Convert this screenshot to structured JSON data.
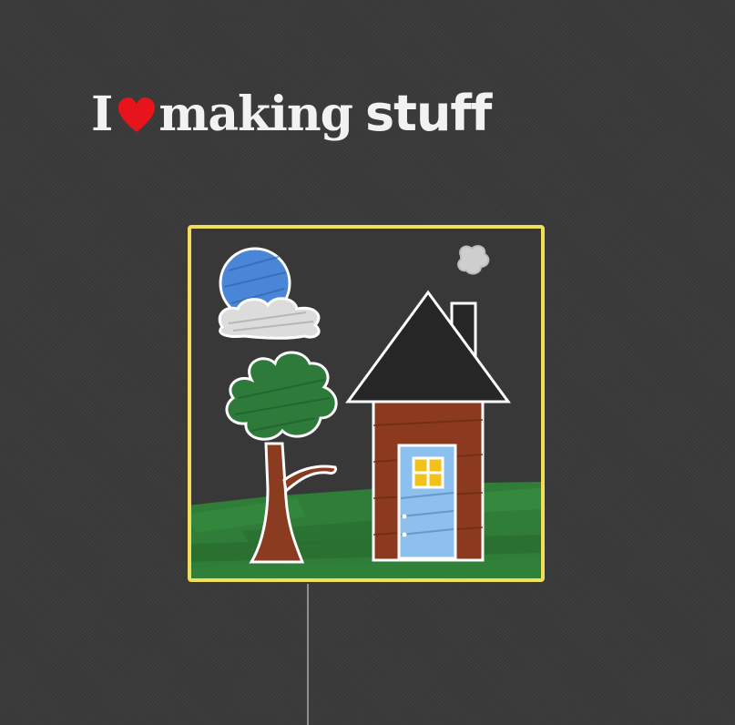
{
  "headline": {
    "word_i": "I",
    "heart_icon": "heart-icon",
    "word_making": "making",
    "word_stuff": "stuff"
  },
  "colors": {
    "background": "#3a3a3a",
    "text": "#f2f2f2",
    "heart": "#e8141b",
    "frame_border": "#f1df5a",
    "sun": "#4a86d8",
    "tree_leaves": "#2e7a3a",
    "tree_trunk": "#8a3b20",
    "grass": "#2f7d38",
    "house_wall": "#8c3a1f",
    "roof": "#262626",
    "door": "#8dc0ec",
    "window_light": "#f2c21a"
  },
  "drawing": {
    "elements": [
      "sun",
      "cloud",
      "smoke",
      "house",
      "roof",
      "chimney",
      "door",
      "window",
      "tree",
      "grass"
    ]
  }
}
